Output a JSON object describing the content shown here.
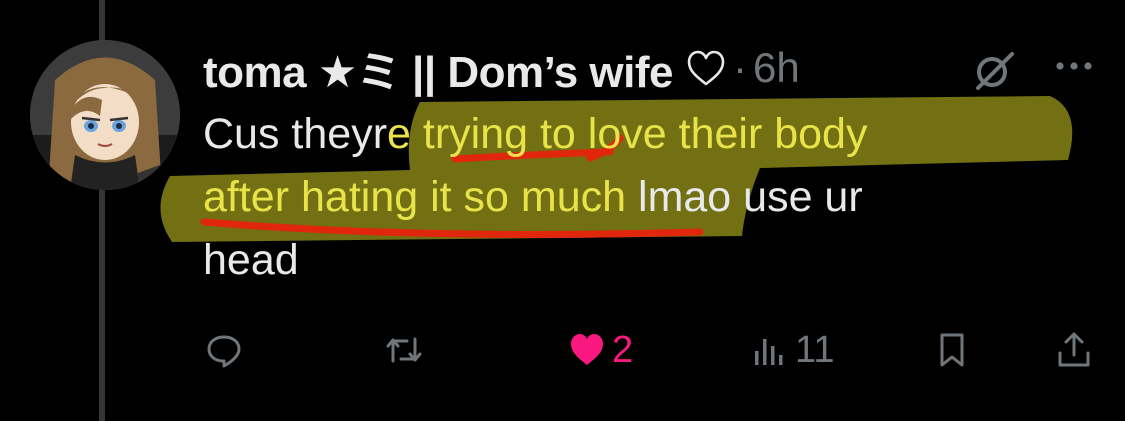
{
  "tweet": {
    "display_name": "toma ★ミ || Dom’s wife",
    "separator": "·",
    "time": "6h",
    "text_parts": {
      "p1": "Cus theyr",
      "p2": "e ",
      "p3": "trying to love their body",
      "p4": "after hating it so much",
      "p5": " lmao use ur",
      "p6": "head"
    }
  },
  "actions": {
    "reply": {
      "icon": "reply-icon",
      "count": ""
    },
    "retweet": {
      "icon": "retweet-icon",
      "count": ""
    },
    "like": {
      "icon": "heart-filled-icon",
      "count": "2",
      "liked": true
    },
    "views": {
      "icon": "views-icon",
      "count": "11"
    },
    "bookmark": {
      "icon": "bookmark-icon",
      "count": ""
    },
    "share": {
      "icon": "share-icon",
      "count": ""
    }
  },
  "colors": {
    "background": "#000000",
    "text": "#e7e9ea",
    "muted": "#71767b",
    "like": "#f91880",
    "highlight_text": "#e9e34a",
    "highlighter": "#7c7a14",
    "underline": "#e0260c"
  }
}
